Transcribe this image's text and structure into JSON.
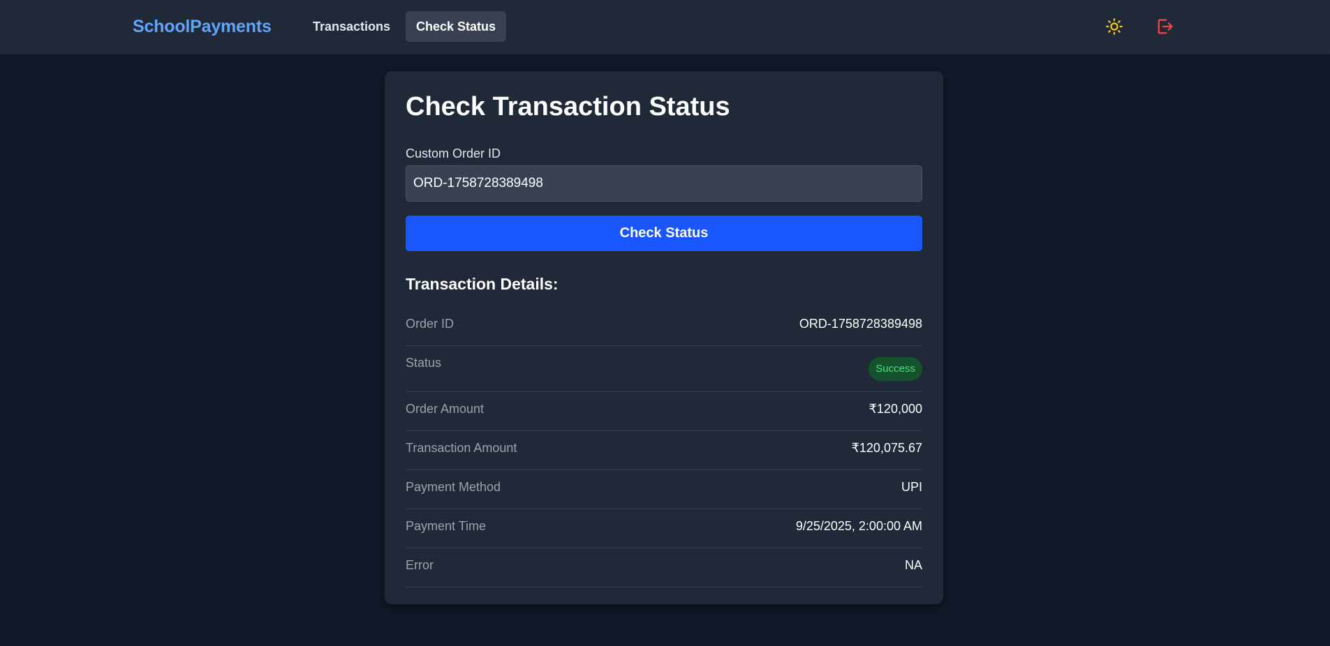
{
  "navbar": {
    "brand": "SchoolPayments",
    "links": [
      {
        "label": "Transactions",
        "active": false
      },
      {
        "label": "Check Status",
        "active": true
      }
    ],
    "icons": {
      "theme_toggle": "sun-icon",
      "logout": "logout-icon"
    }
  },
  "colors": {
    "page_bg": "#111827",
    "surface": "#1f2937",
    "brand": "#60a5fa",
    "primary_button": "#1a56ff",
    "success_badge_bg": "#14532d",
    "success_badge_text": "#4ade80",
    "sun_icon": "#facc15",
    "logout_icon": "#ef4444"
  },
  "form": {
    "title": "Check Transaction Status",
    "field_label": "Custom Order ID",
    "field_value": "ORD-1758728389498",
    "submit_label": "Check Status"
  },
  "details": {
    "heading": "Transaction Details:",
    "rows": [
      {
        "label": "Order ID",
        "value": "ORD-1758728389498"
      },
      {
        "label": "Status",
        "value": "Success"
      },
      {
        "label": "Order Amount",
        "value": "₹120,000"
      },
      {
        "label": "Transaction Amount",
        "value": "₹120,075.67"
      },
      {
        "label": "Payment Method",
        "value": "UPI"
      },
      {
        "label": "Payment Time",
        "value": "9/25/2025, 2:00:00 AM"
      },
      {
        "label": "Error",
        "value": "NA"
      }
    ]
  }
}
